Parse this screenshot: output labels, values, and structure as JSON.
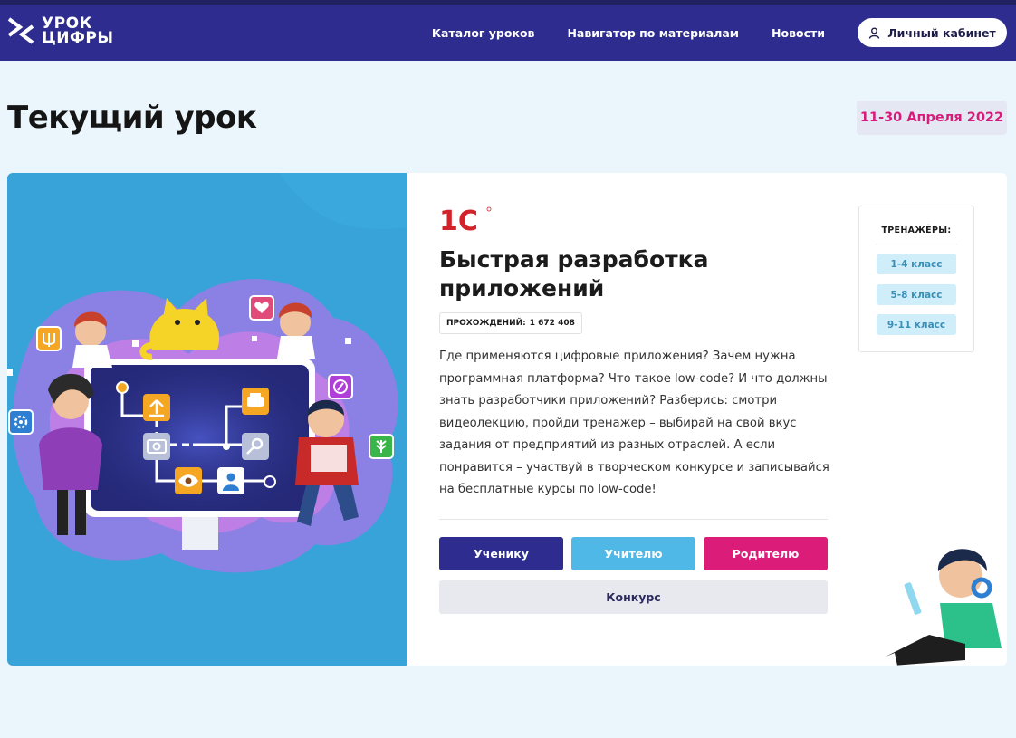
{
  "header": {
    "logo_line1": "УРОК",
    "logo_line2": "ЦИФРЫ",
    "nav": [
      "Каталог уроков",
      "Навигатор по материалам",
      "Новости"
    ],
    "cabinet_label": "Личный кабинет"
  },
  "page": {
    "title": "Текущий урок",
    "date": "11-30 Апреля 2022"
  },
  "lesson": {
    "partner_logo_text": "1С",
    "title": "Быстрая разработка приложений",
    "count_label": "ПРОХОЖДЕНИЙ:",
    "count_value": "1 672 408",
    "description": "Где применяются цифровые приложения? Зачем нужна программная платформа? Что такое low-code? И что должны знать разработчики приложений? Разберись: смотри видеолекцию, пройди тренажер – выбирай на свой вкус задания от предприятий из разных отраслей. А если понравится – участвуй в творческом конкурсе и записывайся на бесплатные курсы по low-code!",
    "buttons": {
      "student": "Ученику",
      "teacher": "Учителю",
      "parent": "Родителю",
      "contest": "Конкурс"
    }
  },
  "trainers": {
    "title": "ТРЕНАЖЁРЫ:",
    "grades": [
      "1-4 класс",
      "5-8 класс",
      "9-11 класс"
    ]
  },
  "colors": {
    "header_bg": "#2e2d8f",
    "accent_pink": "#dc1c79",
    "accent_blue": "#4fb8e6",
    "hero_bg": "#38a3d8",
    "page_bg": "#eaf6fb"
  },
  "icons": [
    "logo-mark-icon",
    "user-icon",
    "upload-icon",
    "printer-icon",
    "camera-icon",
    "search-icon",
    "eye-icon",
    "user-card-icon",
    "heart-icon",
    "gear-icon",
    "compass-icon",
    "leaf-icon",
    "trident-icon"
  ]
}
